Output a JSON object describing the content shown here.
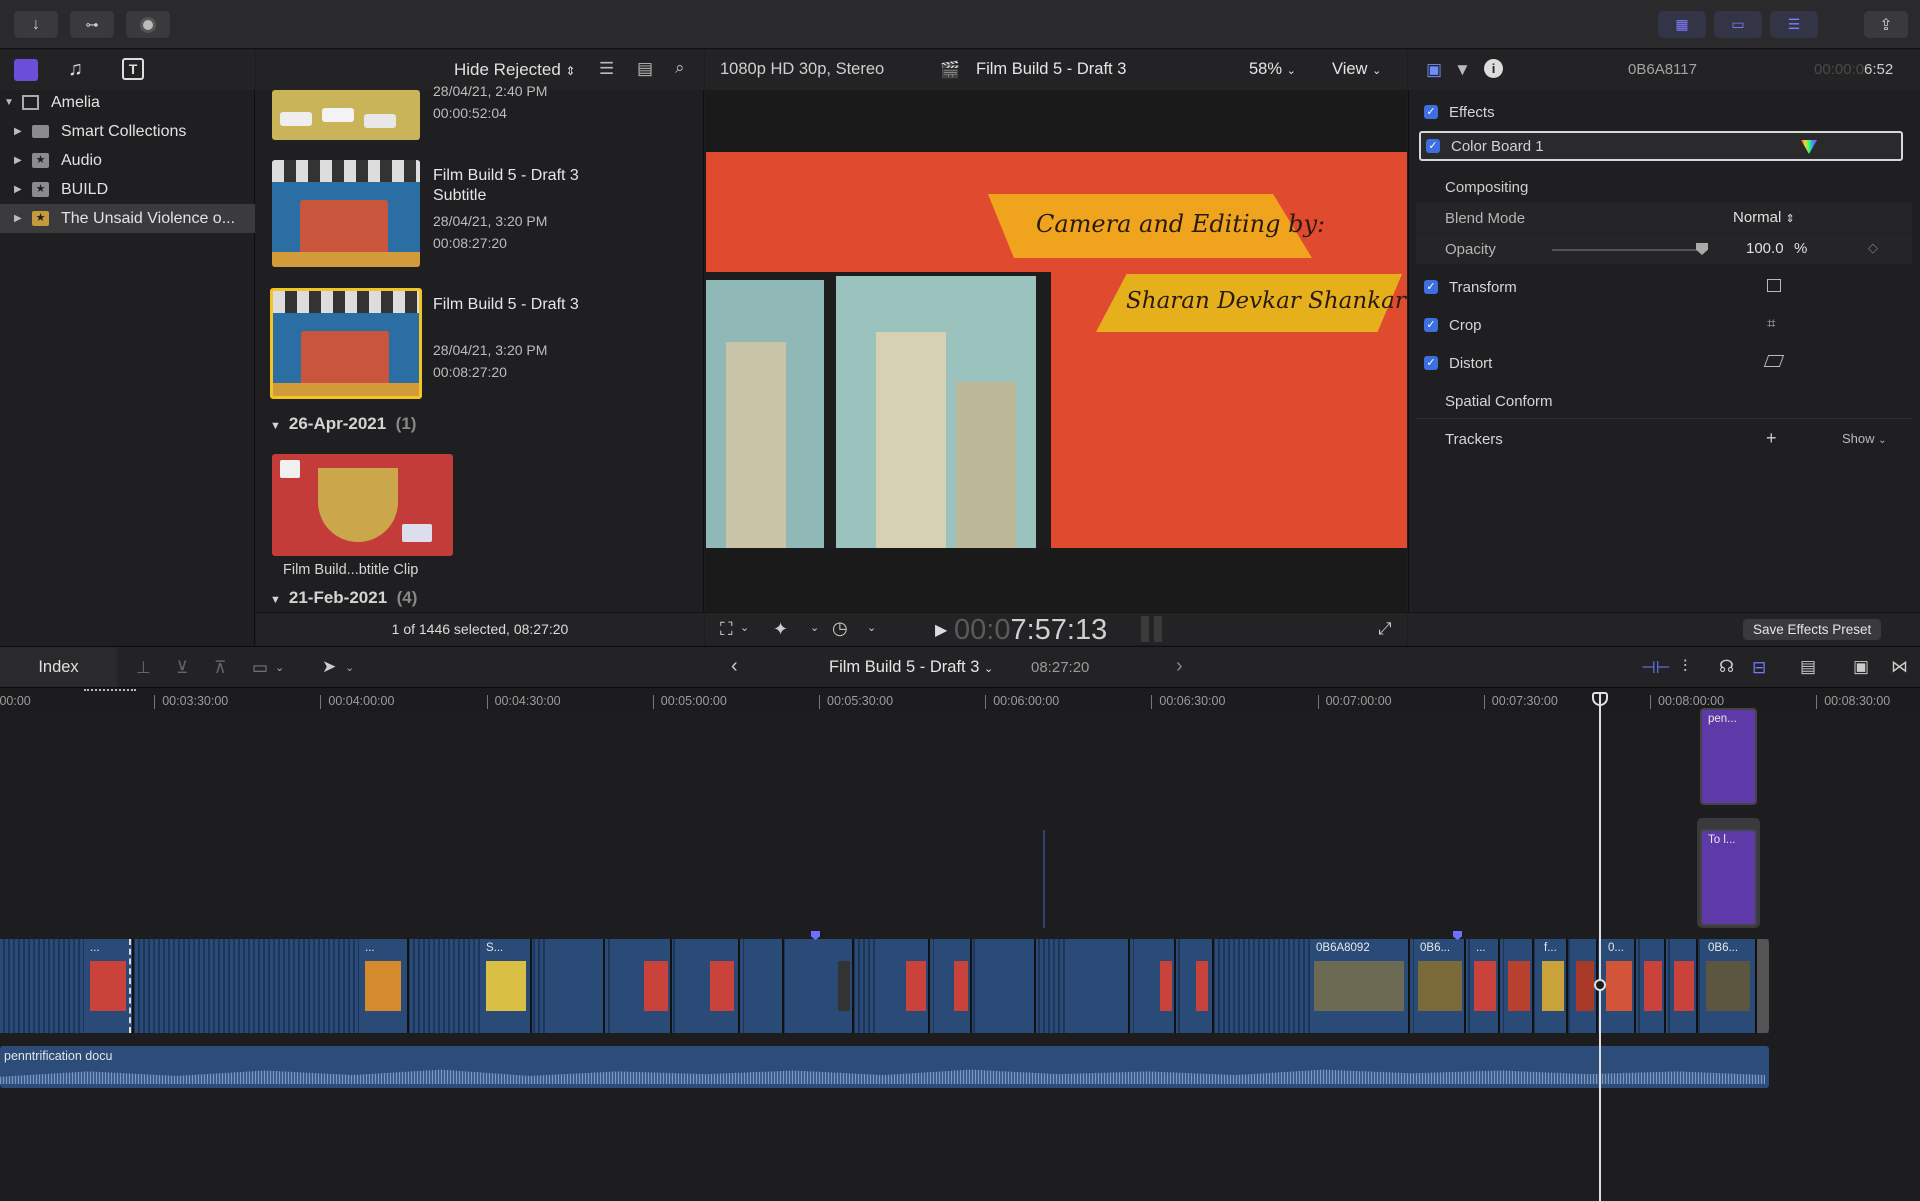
{
  "toolbar": {
    "icons": [
      "import-icon",
      "keywords-icon",
      "background-tasks-icon",
      "browser-layout-icon",
      "timeline-layout-icon",
      "inspector-toggle-icon",
      "share-icon"
    ]
  },
  "library": {
    "items": [
      {
        "label": "Amelia",
        "kind": "library"
      },
      {
        "label": "Smart Collections",
        "kind": "folder"
      },
      {
        "label": "Audio",
        "kind": "star"
      },
      {
        "label": "BUILD",
        "kind": "star"
      },
      {
        "label": "The Unsaid Violence o...",
        "kind": "star",
        "selected": true
      }
    ]
  },
  "browser": {
    "filter": "Hide Rejected",
    "clips": [
      {
        "date": "28/04/21, 2:40 PM",
        "duration": "00:00:52:04"
      },
      {
        "name": "Film Build 5 - Draft 3 Subtitle",
        "date": "28/04/21, 3:20 PM",
        "duration": "00:08:27:20"
      },
      {
        "name": "Film Build 5 - Draft 3",
        "date": "28/04/21, 3:20 PM",
        "duration": "00:08:27:20"
      }
    ],
    "groups": [
      {
        "label": "26-Apr-2021",
        "count": "(1)"
      },
      {
        "label": "21-Feb-2021",
        "count": "(4)"
      }
    ],
    "group_clip": "Film Build...btitle Clip",
    "footer": "1 of 1446 selected, 08:27:20"
  },
  "viewer": {
    "format": "1080p HD 30p, Stereo",
    "project": "Film Build 5 - Draft 3",
    "zoom": "58%",
    "view": "View",
    "timecode_dim": "00:0",
    "timecode": "7:57:13",
    "frame_text_1": "Camera and Editing by:",
    "frame_text_2": "Sharan Devkar Shankar"
  },
  "inspector": {
    "clip_name": "0B6A8117",
    "time_dim": "00:00:0",
    "time": "6:52",
    "effects": "Effects",
    "color_board": "Color Board 1",
    "compositing": "Compositing",
    "blend_mode_label": "Blend Mode",
    "blend_mode_value": "Normal",
    "opacity_label": "Opacity",
    "opacity_value": "100.0",
    "opacity_unit": "%",
    "opacity_level": 1.0,
    "transform": "Transform",
    "crop": "Crop",
    "distort": "Distort",
    "spatial_conform": "Spatial Conform",
    "trackers": "Trackers",
    "trackers_show": "Show",
    "save_preset": "Save Effects Preset"
  },
  "timeline": {
    "index": "Index",
    "project": "Film Build 5 - Draft 3",
    "duration": "08:27:20",
    "ticks": [
      ":00:00",
      "00:03:30:00",
      "00:04:00:00",
      "00:04:30:00",
      "00:05:00:00",
      "00:05:30:00",
      "00:06:00:00",
      "00:06:30:00",
      "00:07:00:00",
      "00:07:30:00",
      "00:08:00:00",
      "00:08:30:00"
    ],
    "clip_labels": [
      "...",
      "...",
      "S...",
      "0B6A8092",
      "0B6...",
      "...",
      "f...",
      "0...",
      "0B6..."
    ],
    "connected": [
      "pen...",
      "To l..."
    ],
    "audio_label": "penntrification docu"
  }
}
